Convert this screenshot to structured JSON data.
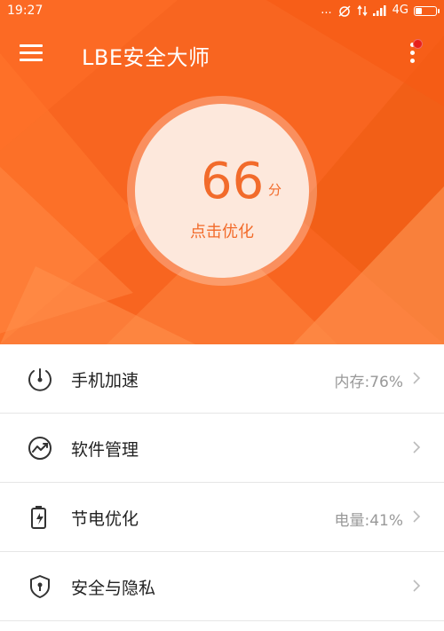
{
  "status_bar": {
    "time": "19:27",
    "dots": "...",
    "network": "4G",
    "icons": [
      "alarm-off-icon",
      "data-transfer-icon",
      "signal-icon",
      "battery-icon"
    ],
    "battery_level": 0.35
  },
  "header": {
    "title": "LBE安全大师",
    "menu_icon": "hamburger-menu-icon",
    "more_icon": "more-vertical-icon",
    "has_notification": true
  },
  "score": {
    "value": "66",
    "unit": "分",
    "action": "点击优化"
  },
  "features": [
    {
      "icon": "speedometer-icon",
      "label": "手机加速",
      "value": "内存:76%"
    },
    {
      "icon": "software-manage-icon",
      "label": "软件管理",
      "value": ""
    },
    {
      "icon": "battery-charging-icon",
      "label": "节电优化",
      "value": "电量:41%"
    },
    {
      "icon": "shield-icon",
      "label": "安全与隐私",
      "value": ""
    }
  ],
  "colors": {
    "accent": "#f86520",
    "score_text": "#f26b2b",
    "notification": "#e8201b"
  }
}
